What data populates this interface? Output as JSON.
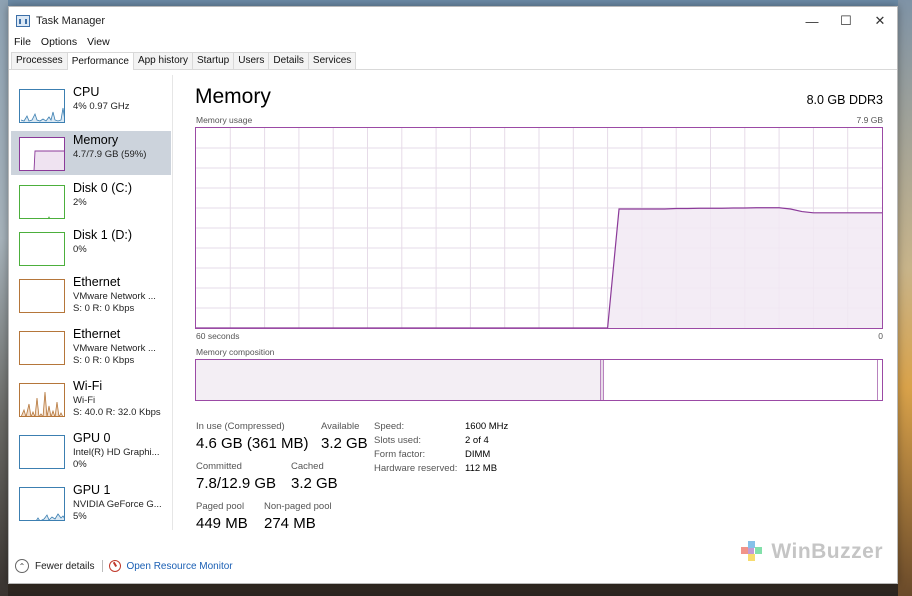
{
  "window": {
    "title": "Task Manager",
    "controls": [
      "—",
      "☐",
      "✕"
    ]
  },
  "menu": [
    "File",
    "Options",
    "View"
  ],
  "tabs": [
    "Processes",
    "Performance",
    "App history",
    "Startup",
    "Users",
    "Details",
    "Services"
  ],
  "active_tab": "Performance",
  "sidebar": {
    "items": [
      {
        "title": "CPU",
        "sub1": "4% 0.97 GHz",
        "sub2": "",
        "color": "#3c7fb1"
      },
      {
        "title": "Memory",
        "sub1": "4.7/7.9 GB (59%)",
        "sub2": "",
        "color": "#8b3a99"
      },
      {
        "title": "Disk 0 (C:)",
        "sub1": "2%",
        "sub2": "",
        "color": "#4caf3c"
      },
      {
        "title": "Disk 1 (D:)",
        "sub1": "0%",
        "sub2": "",
        "color": "#4caf3c"
      },
      {
        "title": "Ethernet",
        "sub1": "VMware Network ...",
        "sub2": "S: 0 R: 0 Kbps",
        "color": "#b5763a"
      },
      {
        "title": "Ethernet",
        "sub1": "VMware Network ...",
        "sub2": "S: 0 R: 0 Kbps",
        "color": "#b5763a"
      },
      {
        "title": "Wi-Fi",
        "sub1": "Wi-Fi",
        "sub2": "S: 40.0  R: 32.0 Kbps",
        "color": "#b5763a"
      },
      {
        "title": "GPU 0",
        "sub1": "Intel(R) HD Graphi...",
        "sub2": "0%",
        "color": "#3c7fb1"
      },
      {
        "title": "GPU 1",
        "sub1": "NVIDIA GeForce G...",
        "sub2": "5%",
        "color": "#3c7fb1"
      }
    ]
  },
  "main": {
    "title": "Memory",
    "spec": "8.0 GB DDR3",
    "usage_label": "Memory usage",
    "usage_max": "7.9 GB",
    "axis_left": "60 seconds",
    "axis_right": "0",
    "composition_label": "Memory composition",
    "composition": {
      "in_use_fraction": 0.59,
      "modified_fraction": 0.005,
      "free_end_fraction": 0.993
    },
    "usage_series": [
      0,
      0,
      0,
      0,
      0,
      0,
      0,
      0,
      0,
      0,
      0,
      0,
      0,
      0,
      0,
      0,
      0,
      0,
      0,
      0,
      0,
      0,
      0,
      0,
      0,
      0,
      0,
      0,
      0,
      0,
      0,
      0,
      0,
      0,
      0,
      0,
      0,
      4.7,
      4.7,
      4.7,
      4.7,
      4.7,
      4.72,
      4.72,
      4.73,
      4.73,
      4.73,
      4.74,
      4.74,
      4.75,
      4.75,
      4.75,
      4.7,
      4.6,
      4.55,
      4.55,
      4.55,
      4.55,
      4.55,
      4.55,
      4.55
    ],
    "stats": {
      "in_use_label": "In use (Compressed)",
      "in_use": "4.6 GB (361 MB)",
      "available_label": "Available",
      "available": "3.2 GB",
      "committed_label": "Committed",
      "committed": "7.8/12.9 GB",
      "cached_label": "Cached",
      "cached": "3.2 GB",
      "paged_label": "Paged pool",
      "paged": "449 MB",
      "nonpaged_label": "Non-paged pool",
      "nonpaged": "274 MB"
    },
    "details": {
      "speed_label": "Speed:",
      "speed": "1600 MHz",
      "slots_label": "Slots used:",
      "slots": "2 of 4",
      "form_label": "Form factor:",
      "form": "DIMM",
      "reserved_label": "Hardware reserved:",
      "reserved": "112 MB"
    }
  },
  "footer": {
    "fewer": "Fewer details",
    "monitor": "Open Resource Monitor"
  },
  "watermark": {
    "text": "WinBuzzer"
  },
  "colors": {
    "memory": "#8b3a99",
    "memory_fill": "#f1e9f3",
    "grid": "#e6dbe8"
  }
}
